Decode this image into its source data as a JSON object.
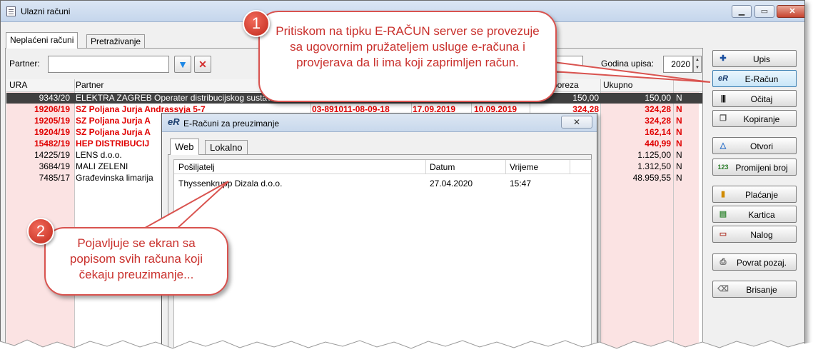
{
  "window": {
    "title": "Ulazni računi"
  },
  "tabs": [
    "Neplaćeni računi",
    "Pretraživanje"
  ],
  "filters": {
    "partner_label": "Partner:",
    "partner_value": "",
    "year_label": "Godina upisa:",
    "year_value": "2020"
  },
  "grid": {
    "columns": {
      "ura": "URA",
      "partner": "Partner",
      "poreza": "poreza",
      "ukupno": "Ukupno"
    },
    "rows": [
      {
        "ura": "9343/20",
        "partner": "ELEKTRA ZAGREB Operater distribucijskog sustava",
        "col3": "",
        "col4": "",
        "col5": "",
        "poreza": "150,00",
        "ukupno": "150,00",
        "flag": "N",
        "style": "sel"
      },
      {
        "ura": "19206/19",
        "partner": "SZ Poljana Jurja Andrassyja 5-7",
        "col3": "03-891011-08-09-18",
        "col4": "10.09.2019",
        "col5": "17.09.2019",
        "poreza": "324,28",
        "ukupno": "324,28",
        "flag": "N",
        "style": "red"
      },
      {
        "ura": "19205/19",
        "partner": "SZ Poljana Jurja A",
        "col3": "",
        "col4": "",
        "col5": "",
        "poreza": "",
        "ukupno": "324,28",
        "flag": "N",
        "style": "red"
      },
      {
        "ura": "19204/19",
        "partner": "SZ Poljana Jurja A",
        "col3": "",
        "col4": "",
        "col5": "",
        "poreza": "",
        "ukupno": "162,14",
        "flag": "N",
        "style": "red"
      },
      {
        "ura": "15482/19",
        "partner": "HEP DISTRIBUCIJ",
        "col3": "",
        "col4": "",
        "col5": "",
        "poreza": "",
        "ukupno": "440,99",
        "flag": "N",
        "style": "red"
      },
      {
        "ura": "14225/19",
        "partner": "LENS d.o.o.",
        "col3": "",
        "col4": "",
        "col5": "",
        "poreza": "",
        "ukupno": "1.125,00",
        "flag": "N",
        "style": ""
      },
      {
        "ura": "3684/19",
        "partner": "MALI ZELENI",
        "col3": "",
        "col4": "",
        "col5": "",
        "poreza": "",
        "ukupno": "1.312,50",
        "flag": "N",
        "style": ""
      },
      {
        "ura": "7485/17",
        "partner": "Građevinska limarija",
        "col3": "",
        "col4": "",
        "col5": "",
        "poreza": "",
        "ukupno": "48.959,55",
        "flag": "N",
        "style": ""
      }
    ]
  },
  "side_buttons": [
    {
      "label": "Upis",
      "icon": "add-icon"
    },
    {
      "label": "E-Račun",
      "icon": "eracun-icon"
    },
    {
      "label": "Očitaj",
      "icon": "barcode-icon"
    },
    {
      "label": "Kopiranje",
      "icon": "copy-icon"
    },
    {
      "label": "Otvori",
      "icon": "triangle-icon"
    },
    {
      "label": "Promijeni broj",
      "icon": "numbers-icon"
    },
    {
      "label": "Plaćanje",
      "icon": "payment-icon"
    },
    {
      "label": "Kartica",
      "icon": "card-icon"
    },
    {
      "label": "Nalog",
      "icon": "order-icon"
    },
    {
      "label": "Povrat pozaj.",
      "icon": "printer-icon"
    },
    {
      "label": "Brisanje",
      "icon": "eraser-icon"
    }
  ],
  "dialog": {
    "title": "E-Računi za preuzimanje",
    "logo": "eR",
    "tabs": [
      "Web",
      "Lokalno"
    ],
    "columns": {
      "sender": "Pošiljatelj",
      "date": "Datum",
      "time": "Vrijeme"
    },
    "rows": [
      {
        "sender": "Thyssenkrupp Dizala d.o.o.",
        "date": "27.04.2020",
        "time": "15:47"
      }
    ]
  },
  "callouts": [
    {
      "number": "1",
      "text": "Pritiskom na tipku E-RAČUN server se provezuje sa ugovornim pružateljem usluge e-računa i provjerava da li ima koji zaprimljen račun."
    },
    {
      "number": "2",
      "text": "Pojavljuje se ekran sa popisom svih računa koji čekaju preuzimanje..."
    }
  ],
  "colors": {
    "accent_red": "#d9534f",
    "row_red": "#e00000",
    "selected_row": "#404040",
    "pink_column": "#fbe3e3"
  }
}
